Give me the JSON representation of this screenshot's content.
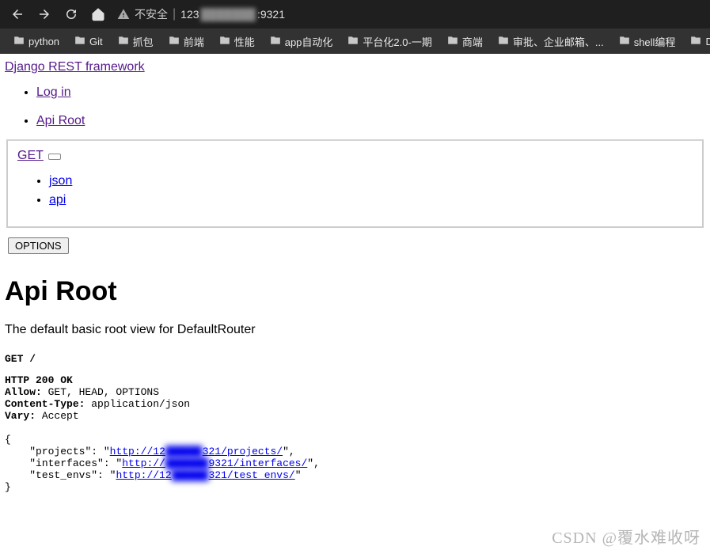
{
  "browser": {
    "secure_label": "不安全",
    "url_prefix": "123",
    "url_blur": "███████",
    "url_suffix": ":9321"
  },
  "bookmarks": [
    "python",
    "Git",
    "抓包",
    "前端",
    "性能",
    "app自动化",
    "平台化2.0-一期",
    "商端",
    "审批、企业邮箱、...",
    "shell编程",
    "Dj"
  ],
  "links": {
    "brand": "Django REST framework",
    "login": "Log in",
    "breadcrumb": "Api Root",
    "get": "GET",
    "json": "json",
    "api": "api"
  },
  "buttons": {
    "options": "OPTIONS"
  },
  "page": {
    "title": "Api Root",
    "description": "The default basic root view for DefaultRouter"
  },
  "response": {
    "request_line": "GET /",
    "status": "HTTP 200 OK",
    "allow_label": "Allow:",
    "allow_value": " GET, HEAD, OPTIONS",
    "ctype_label": "Content-Type:",
    "ctype_value": " application/json",
    "vary_label": "Vary:",
    "vary_value": " Accept",
    "body": {
      "k1": "projects",
      "v1a": "http://12",
      "v1b": "321/projects/",
      "k2": "interfaces",
      "v2a": "http://",
      "v2b": "9321/interfaces/",
      "k3": "test_envs",
      "v3a": "http://12",
      "v3b": "321/test_envs/"
    }
  },
  "watermark": "CSDN @覆水难收呀"
}
